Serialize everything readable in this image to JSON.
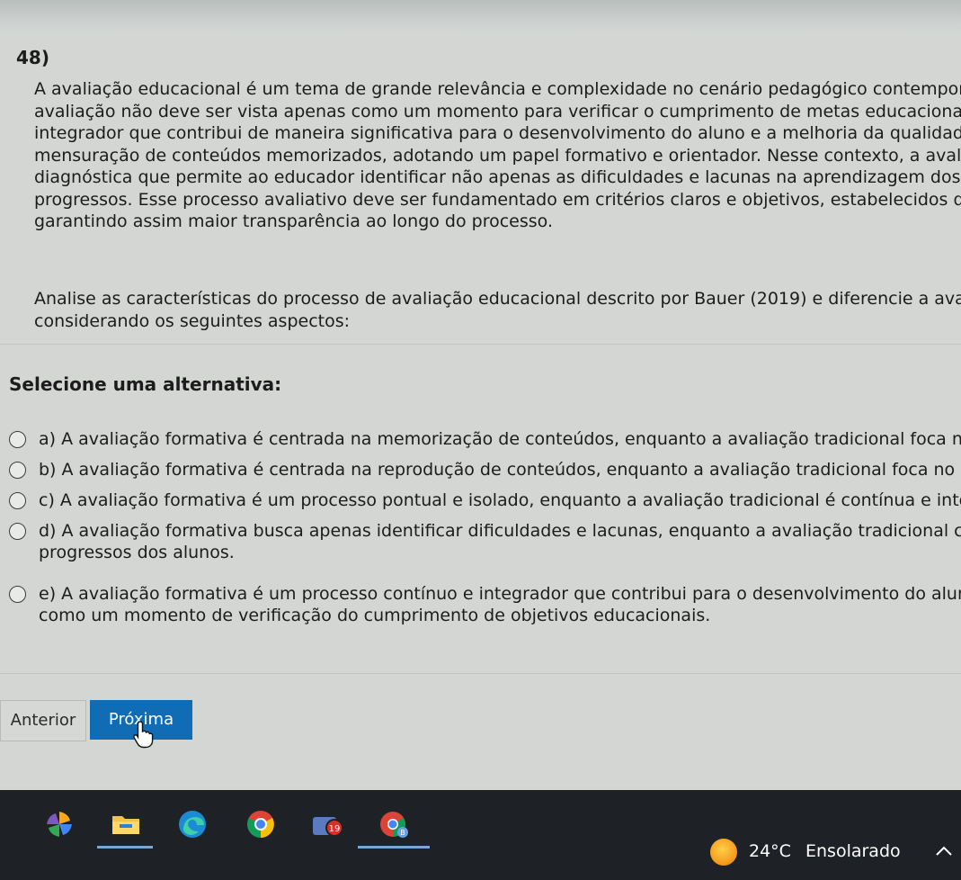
{
  "question": {
    "number": "48)",
    "context_lines": [
      "A avaliação educacional é um tema de grande relevância e complexidade no cenário pedagógico contemporâne",
      "avaliação não deve ser vista apenas como um momento para verificar o cumprimento de metas educacionais, r",
      "integrador que contribui de maneira significativa para o desenvolvimento do aluno e a melhoria da qualidade d",
      "mensuração de conteúdos memorizados, adotando um papel formativo e orientador. Nesse contexto, a avaliaç",
      "diagnóstica que permite ao educador identificar não apenas as dificuldades e lacunas na aprendizagem dos alu",
      "progressos. Esse processo avaliativo deve ser fundamentado em critérios claros e objetivos, estabelecidos de fo",
      "garantindo assim maior transparência ao longo do processo."
    ],
    "prompt_lines": [
      "Analise as características do processo de avaliação educacional descrito por Bauer (2019) e diferencie a avaliação",
      "considerando os seguintes aspectos:"
    ]
  },
  "select_label": "Selecione uma alternativa:",
  "options": [
    {
      "lines": [
        "a) A avaliação formativa é centrada na memorização de conteúdos, enquanto a avaliação tradicional foca no o"
      ]
    },
    {
      "lines": [
        "b) A avaliação formativa é centrada na reprodução de conteúdos, enquanto a avaliação tradicional foca no des"
      ]
    },
    {
      "lines": [
        "c) A avaliação formativa é um processo pontual e isolado, enquanto a avaliação tradicional é contínua e integra"
      ]
    },
    {
      "lines": [
        "d) A avaliação formativa busca apenas identificar dificuldades e lacunas, enquanto a avaliação tradicional cons",
        "progressos dos alunos."
      ]
    },
    {
      "lines": [
        "e) A avaliação formativa é um processo contínuo e integrador que contribui para o desenvolvimento do aluno,",
        "como um momento de verificação do cumprimento de objetivos educacionais."
      ]
    }
  ],
  "nav": {
    "prev_label": "Anterior",
    "next_label": "Próxima"
  },
  "colors": {
    "next_button": "#0f6cb5",
    "taskbar": "#1e2226"
  },
  "taskbar": {
    "icons": [
      "pinwheel-app-icon",
      "file-explorer-icon",
      "edge-browser-icon",
      "chrome-browser-icon",
      "badge-app-icon",
      "profile-browser-icon"
    ],
    "badge_count": "19",
    "profile_letter": "B",
    "weather": {
      "temperature": "24°C",
      "condition": "Ensolarado"
    }
  }
}
